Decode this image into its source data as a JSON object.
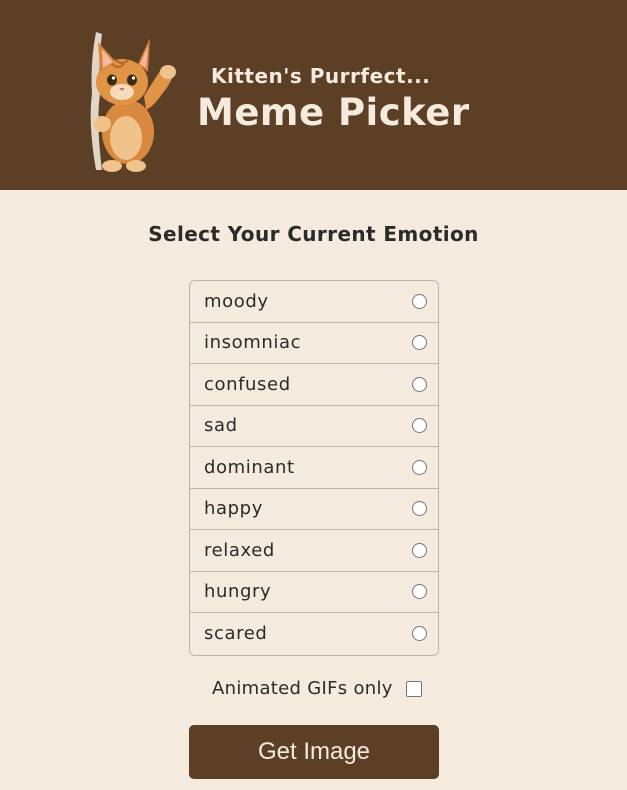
{
  "header": {
    "subtitle": "Kitten's Purrfect...",
    "title": "Meme Picker",
    "logo_icon": "kitten-icon"
  },
  "prompt": "Select Your Current Emotion",
  "emotions": [
    {
      "label": "moody",
      "selected": false
    },
    {
      "label": "insomniac",
      "selected": false
    },
    {
      "label": "confused",
      "selected": false
    },
    {
      "label": "sad",
      "selected": false
    },
    {
      "label": "dominant",
      "selected": false
    },
    {
      "label": "happy",
      "selected": false
    },
    {
      "label": "relaxed",
      "selected": false
    },
    {
      "label": "hungry",
      "selected": false
    },
    {
      "label": "scared",
      "selected": false
    }
  ],
  "gif_option": {
    "label": "Animated GIFs only",
    "checked": false
  },
  "button": {
    "label": "Get Image"
  },
  "colors": {
    "brand_brown": "#5c3f25",
    "background": "#f4eadd",
    "text": "#2b2b2b"
  }
}
